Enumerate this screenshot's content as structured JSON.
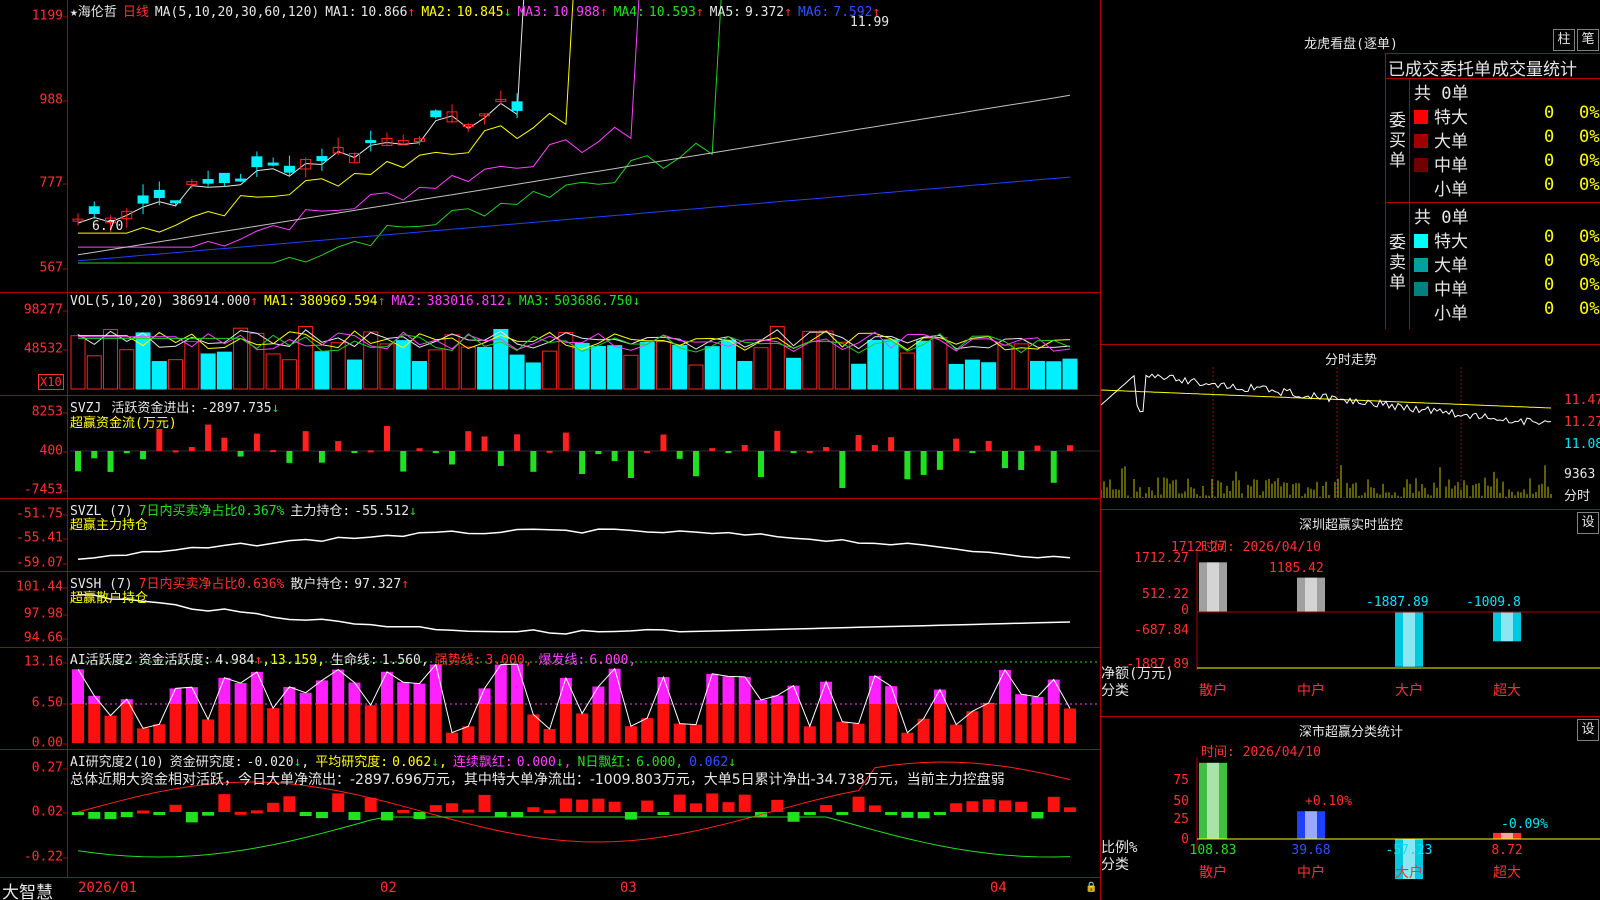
{
  "app": {
    "brand": "大智慧",
    "stock_star": "★",
    "stock_name": "海伦哲",
    "period": "日线"
  },
  "colors": {
    "up": "#ff2020",
    "down": "#00f0ff",
    "ma1": "#e6e6e6",
    "ma2": "#ffff00",
    "ma3": "#ff40ff",
    "ma4": "#20d020",
    "ma5": "#c0c0c0",
    "ma6": "#2040ff"
  },
  "kline": {
    "title": "MA(5,10,20,30,60,120)",
    "ma1_label": "MA1:",
    "ma1_value": "10.866",
    "ma1_dir": "↑",
    "ma2_label": "MA2:",
    "ma2_value": "10.845",
    "ma2_dir": "↓",
    "ma3_label": "MA3:",
    "ma3_value": "10.988",
    "ma3_dir": "↑",
    "ma4_label": "MA4:",
    "ma4_value": "10.593",
    "ma4_dir": "↑",
    "ma5_label": "MA5:",
    "ma5_value": "9.372",
    "ma5_dir": "↑",
    "ma6_label": "MA6:",
    "ma6_value": "7.592",
    "ma6_dir": "↑",
    "high_mark": "11.99",
    "low_mark": "6.70",
    "yticks": [
      "1199",
      "988",
      "777",
      "567"
    ]
  },
  "vol": {
    "title": "VOL(5,10,20)",
    "value": "386914.000",
    "value_dir": "↑",
    "ma1_label": "MA1:",
    "ma1_value": "380969.594",
    "ma1_dir": "↑",
    "ma2_label": "MA2:",
    "ma2_value": "383016.812",
    "ma2_dir": "↓",
    "ma3_label": "MA3:",
    "ma3_value": "503686.750",
    "ma3_dir": "↓",
    "yticks": [
      "98277",
      "48532"
    ],
    "unit": "X10"
  },
  "svzj": {
    "title": "SVZJ",
    "label": "活跃资金进出:",
    "value": "-2897.735",
    "dir": "↓",
    "sub": "超赢资金流(万元)",
    "yticks": [
      "8253",
      "400",
      "-7453"
    ]
  },
  "svzl": {
    "title": "SVZL (7)",
    "label1": "7日内买卖净占比0.367%",
    "label2": "主力持仓:",
    "value": "-55.512",
    "dir": "↓",
    "sub": "超赢主力持仓",
    "yticks": [
      "-51.75",
      "-55.41",
      "-59.07"
    ]
  },
  "svsh": {
    "title": "SVSH (7)",
    "label1": "7日内买卖净占比0.636%",
    "label2": "散户持仓:",
    "value": "97.327",
    "dir": "↑",
    "sub": "超赢散户持仓",
    "yticks": [
      "101.44",
      "97.98",
      "94.66"
    ]
  },
  "ai_act": {
    "title": "AI活跃度2",
    "l1": "资金活跃度:",
    "v1": "4.984",
    "d1": "↑",
    "v2": "13.159",
    "l3": "生命线:",
    "v3": "1.560",
    "l4": "强势线:",
    "v4": "3.000",
    "l5": "爆发线:",
    "v5": "6.000",
    "yticks": [
      "13.16",
      "6.50",
      "0.00"
    ]
  },
  "ai_res": {
    "title": "AI研究度2(10)",
    "l1": "资金研究度:",
    "v1": "-0.020",
    "d1": "↓",
    "l2": "平均研究度:",
    "v2": "0.062",
    "d2": "↓",
    "l3": "连续飘红:",
    "v3": "0.000",
    "d3": "↓",
    "l4": "N日飘红:",
    "v4": "6.000",
    "v5": "0.062",
    "d5": "↓",
    "summary": "总体近期大资金相对活跃，今日大单净流出：-2897.696万元，其中特大单净流出：-1009.803万元，大单5日累计净出-34.738万元，当前主力控盘弱",
    "yticks": [
      "0.27",
      "0.02",
      "-0.22"
    ]
  },
  "xaxis": [
    "2026/01",
    "02",
    "03",
    "04"
  ],
  "lhb": {
    "title": "龙虎看盘(逐单)",
    "btn1": "柱",
    "btn2": "笔",
    "tabs": [
      "已成交",
      "委托单",
      "成交量统计"
    ],
    "buy": {
      "side": "委买单",
      "total": "共 0单",
      "rows": [
        {
          "name": "特大",
          "v": "0",
          "p": "0%",
          "c": "#ff0000"
        },
        {
          "name": "大单",
          "v": "0",
          "p": "0%",
          "c": "#a00000"
        },
        {
          "name": "中单",
          "v": "0",
          "p": "0%",
          "c": "#700000"
        },
        {
          "name": "小单",
          "v": "0",
          "p": "0%",
          "c": "#000000"
        }
      ]
    },
    "sell": {
      "side": "委卖单",
      "total": "共 0单",
      "rows": [
        {
          "name": "特大",
          "v": "0",
          "p": "0%",
          "c": "#00ffff"
        },
        {
          "name": "大单",
          "v": "0",
          "p": "0%",
          "c": "#00a0a0"
        },
        {
          "name": "中单",
          "v": "0",
          "p": "0%",
          "c": "#008080"
        },
        {
          "name": "小单",
          "v": "0",
          "p": "0%",
          "c": "#000000"
        }
      ]
    }
  },
  "intraday": {
    "title": "分时走势",
    "yticks": [
      "11.47",
      "11.27",
      "11.08"
    ],
    "vol_top": "9363",
    "unit": "分时"
  },
  "sz_monitor": {
    "title": "深圳超赢实时监控",
    "btn": "设",
    "time": "时间: 2026/04/10",
    "yticks": [
      "1712.27",
      "512.22",
      "0",
      "-687.84",
      "-1887.89"
    ],
    "ylabel": "净额(万元)",
    "xlabel": "分类",
    "cats": [
      "散户",
      "中户",
      "大户",
      "超大"
    ],
    "values": [
      "1712.27",
      "1185.42",
      "-1887.89",
      "-1009.8"
    ]
  },
  "sz_stat": {
    "title": "深市超赢分类统计",
    "btn": "设",
    "time": "时间: 2026/04/10",
    "yticks": [
      "75",
      "50",
      "25",
      "0"
    ],
    "ylabel": "比例%",
    "xlabel": "分类",
    "cats": [
      "散户",
      "中户",
      "大户",
      "超大"
    ],
    "values": [
      "108.83",
      "39.68",
      "-57.23",
      "8.72"
    ],
    "anno": [
      "+0.10%",
      "-0.09%"
    ]
  }
}
